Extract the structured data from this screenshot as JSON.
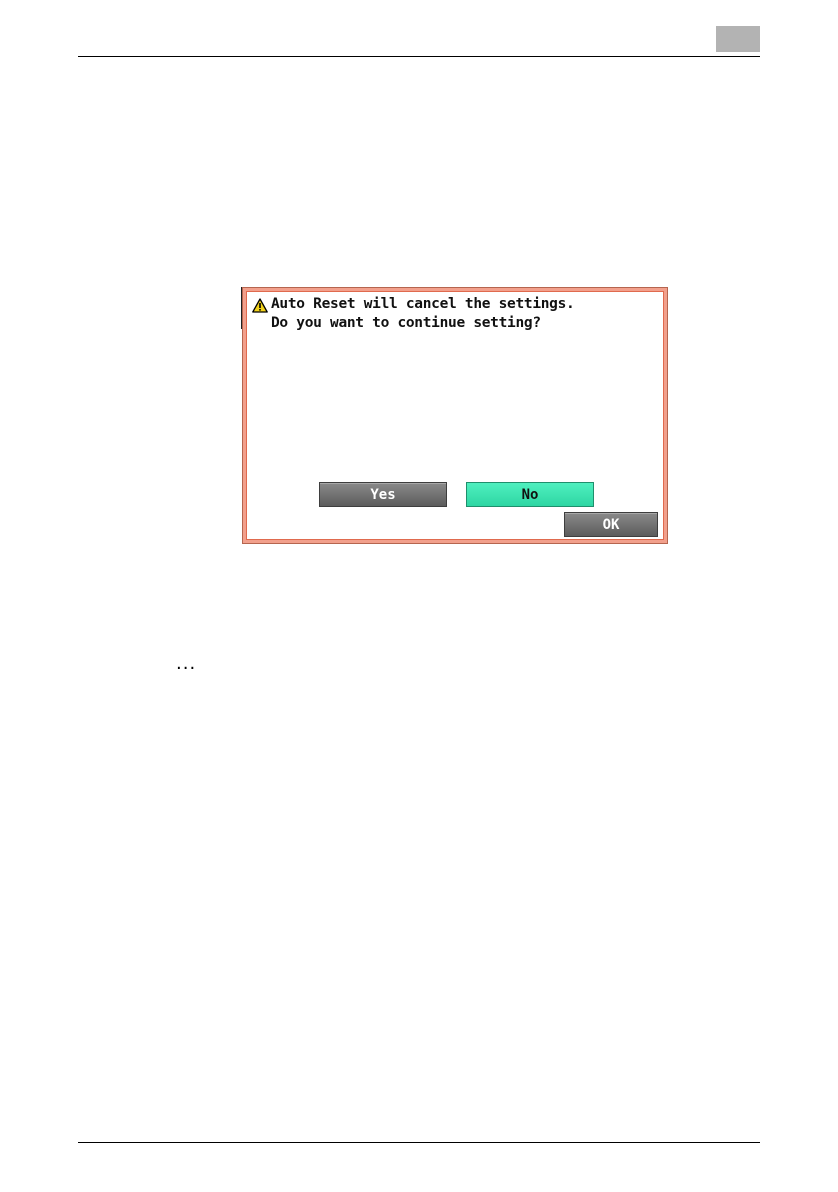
{
  "dialog": {
    "icon": "warning-icon",
    "message_line1": "Auto Reset will cancel the settings.",
    "message_line2": "Do you want to continue setting?",
    "yes_label": "Yes",
    "no_label": "No",
    "ok_label": "OK",
    "border_color": "#e06a4e",
    "selected_button_color": "#3be5b1"
  },
  "page": {
    "note_marker": "..."
  }
}
